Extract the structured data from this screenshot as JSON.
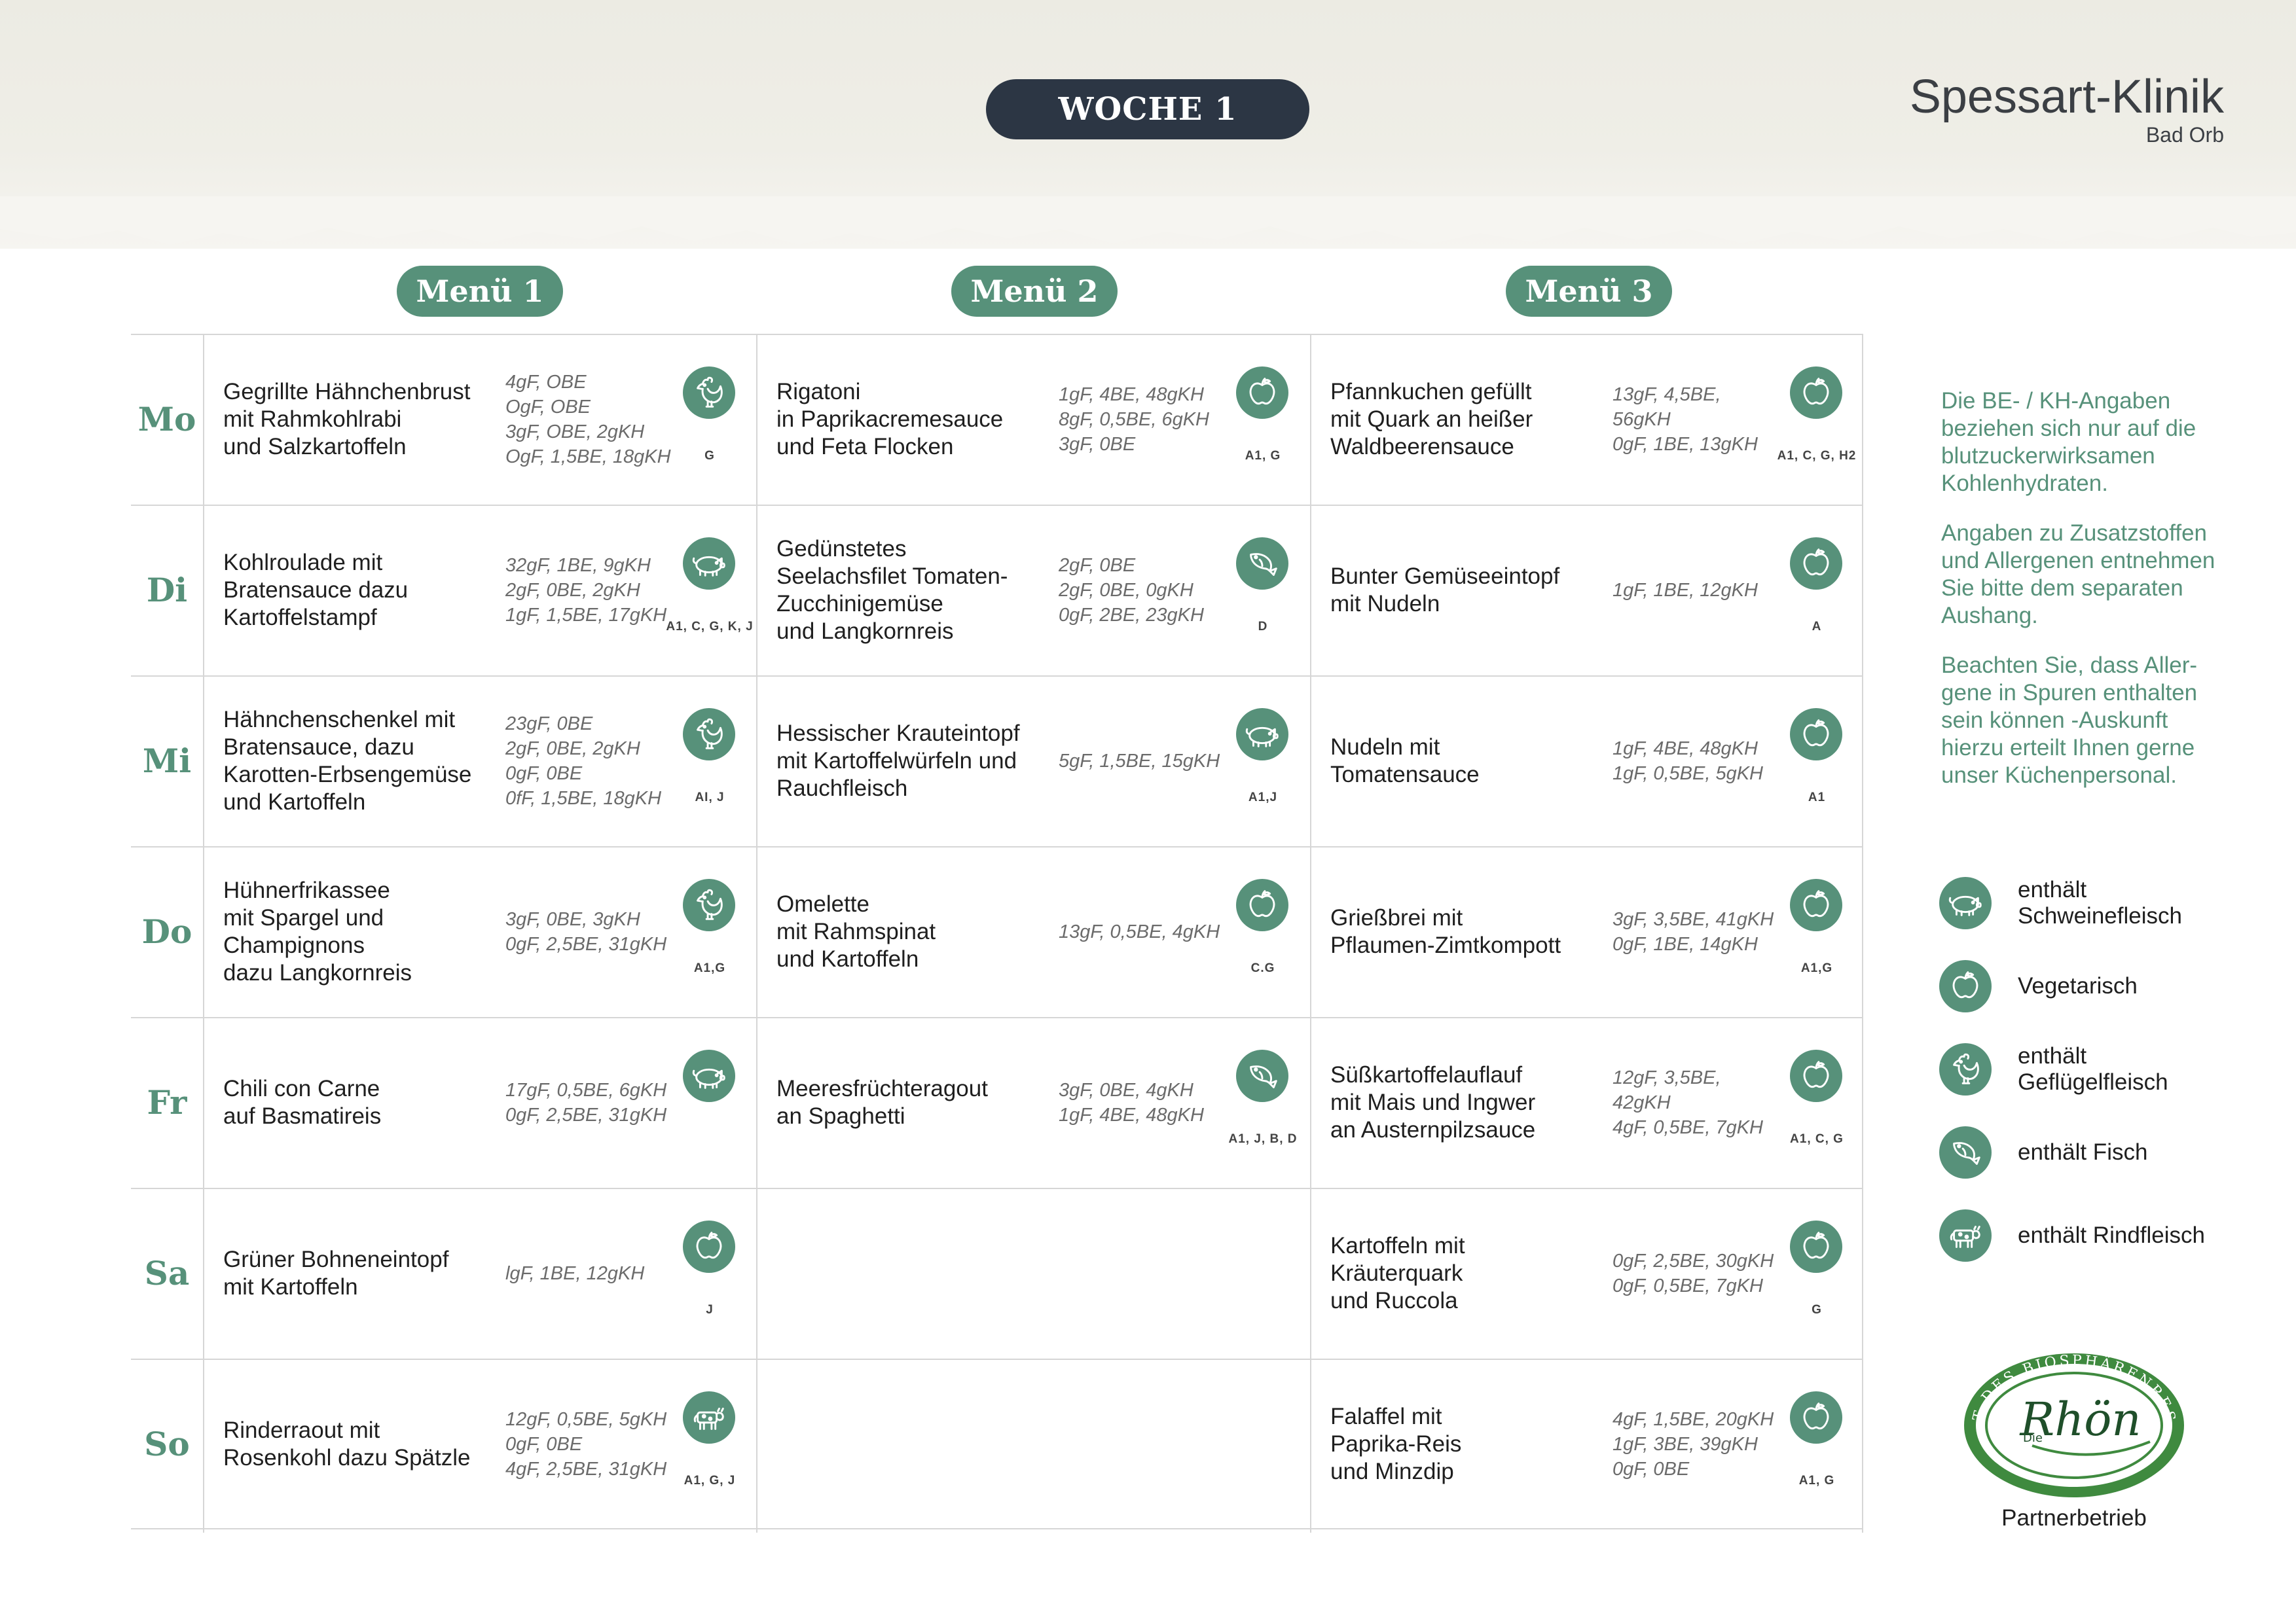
{
  "header": {
    "week": "WOCHE 1",
    "brand": "Spessart-Klinik",
    "brand_sub": "Bad Orb"
  },
  "menus": [
    "Menü 1",
    "Menü 2",
    "Menü 3"
  ],
  "rows": [
    {
      "day": "Mo",
      "cells": [
        {
          "dish": [
            "Gegrillte Hähnchenbrust",
            "mit Rahmkohlrabi",
            "und Salzkartoffeln"
          ],
          "nutri": [
            "4gF, OBE",
            "OgF, OBE",
            "3gF, OBE, 2gKH",
            "OgF, 1,5BE, 18gKH"
          ],
          "icon": "chicken-icon",
          "allergens": "G"
        },
        {
          "dish": [
            "Rigatoni",
            "in Paprikacremesauce",
            "und Feta Flocken"
          ],
          "nutri": [
            "1gF, 4BE, 48gKH",
            "8gF, 0,5BE, 6gKH",
            "3gF, 0BE"
          ],
          "icon": "apple-icon",
          "allergens": "A1, G"
        },
        {
          "dish": [
            "Pfannkuchen gefüllt",
            "mit Quark an heißer",
            "Waldbeerensauce"
          ],
          "nutri": [
            "13gF, 4,5BE,",
            "56gKH",
            "0gF, 1BE, 13gKH"
          ],
          "icon": "apple-icon",
          "allergens": "A1, C, G, H2"
        }
      ]
    },
    {
      "day": "Di",
      "cells": [
        {
          "dish": [
            "Kohlroulade mit",
            "Bratensauce dazu",
            "Kartoffelstampf"
          ],
          "nutri": [
            "32gF, 1BE, 9gKH",
            "2gF, 0BE, 2gKH",
            "1gF, 1,5BE, 17gKH"
          ],
          "icon": "pig-icon",
          "allergens": "A1, C, G, K, J"
        },
        {
          "dish": [
            "Gedünstetes",
            "Seelachsfilet Tomaten-",
            "Zucchinigemüse",
            "und Langkornreis"
          ],
          "nutri": [
            "2gF, 0BE",
            "2gF, 0BE, 0gKH",
            "0gF, 2BE, 23gKH"
          ],
          "icon": "fish-icon",
          "allergens": "D"
        },
        {
          "dish": [
            "Bunter Gemüseeintopf",
            "mit Nudeln"
          ],
          "nutri": [
            "1gF, 1BE, 12gKH"
          ],
          "icon": "apple-icon",
          "allergens": "A"
        }
      ]
    },
    {
      "day": "Mi",
      "cells": [
        {
          "dish": [
            "Hähnchenschenkel mit",
            "Bratensauce, dazu",
            "Karotten-Erbsengemüse",
            "und Kartoffeln"
          ],
          "nutri": [
            "23gF, 0BE",
            "2gF, 0BE, 2gKH",
            "0gF, 0BE",
            "0fF, 1,5BE, 18gKH"
          ],
          "icon": "chicken-icon",
          "allergens": "AI, J"
        },
        {
          "dish": [
            "Hessischer Krauteintopf",
            "mit Kartoffelwürfeln und",
            "Rauchfleisch"
          ],
          "nutri": [
            "5gF, 1,5BE, 15gKH"
          ],
          "icon": "pig-icon",
          "allergens": "A1,J"
        },
        {
          "dish": [
            "Nudeln mit",
            "Tomatensauce"
          ],
          "nutri": [
            "1gF, 4BE, 48gKH",
            "1gF, 0,5BE, 5gKH"
          ],
          "icon": "apple-icon",
          "allergens": "A1"
        }
      ]
    },
    {
      "day": "Do",
      "cells": [
        {
          "dish": [
            "Hühnerfrikassee",
            "mit Spargel und",
            "Champignons",
            "dazu Langkornreis"
          ],
          "nutri": [
            "3gF, 0BE, 3gKH",
            "0gF, 2,5BE, 31gKH"
          ],
          "icon": "chicken-icon",
          "allergens": "A1,G"
        },
        {
          "dish": [
            "Omelette",
            "mit Rahmspinat",
            "und Kartoffeln"
          ],
          "nutri": [
            "13gF, 0,5BE, 4gKH"
          ],
          "icon": "apple-icon",
          "allergens": "C.G"
        },
        {
          "dish": [
            "Grießbrei mit",
            "Pflaumen-Zimtkompott"
          ],
          "nutri": [
            "3gF, 3,5BE, 41gKH",
            "0gF, 1BE, 14gKH"
          ],
          "icon": "apple-icon",
          "allergens": "A1,G"
        }
      ]
    },
    {
      "day": "Fr",
      "cells": [
        {
          "dish": [
            "Chili con Carne",
            "auf Basmatireis"
          ],
          "nutri": [
            "17gF, 0,5BE, 6gKH",
            "0gF, 2,5BE, 31gKH"
          ],
          "icon": "pig-icon",
          "allergens": ""
        },
        {
          "dish": [
            "Meeresfrüchteragout",
            "an Spaghetti"
          ],
          "nutri": [
            "3gF, 0BE, 4gKH",
            "1gF, 4BE, 48gKH"
          ],
          "icon": "fish-icon",
          "allergens": "A1, J, B, D"
        },
        {
          "dish": [
            "Süßkartoffelauflauf",
            "mit Mais und Ingwer",
            "an Austernpilzsauce"
          ],
          "nutri": [
            "12gF, 3,5BE,",
            "42gKH",
            "4gF, 0,5BE, 7gKH"
          ],
          "icon": "apple-icon",
          "allergens": "A1, C, G"
        }
      ]
    },
    {
      "day": "Sa",
      "cells": [
        {
          "dish": [
            "Grüner Bohneneintopf",
            "mit Kartoffeln"
          ],
          "nutri": [
            "lgF, 1BE, 12gKH"
          ],
          "icon": "apple-icon",
          "allergens": "J"
        },
        {
          "dish": [],
          "nutri": [],
          "icon": "",
          "allergens": ""
        },
        {
          "dish": [
            "Kartoffeln mit",
            "Kräuterquark",
            "und Ruccola"
          ],
          "nutri": [
            "0gF, 2,5BE, 30gKH",
            "0gF, 0,5BE, 7gKH"
          ],
          "icon": "apple-icon",
          "allergens": "G"
        }
      ]
    },
    {
      "day": "So",
      "cells": [
        {
          "dish": [
            "Rinderraout mit",
            "Rosenkohl dazu Spätzle"
          ],
          "nutri": [
            "12gF, 0,5BE, 5gKH",
            "0gF, 0BE",
            "4gF, 2,5BE, 31gKH"
          ],
          "icon": "cow-icon",
          "allergens": "A1, G, J"
        },
        {
          "dish": [],
          "nutri": [],
          "icon": "",
          "allergens": ""
        },
        {
          "dish": [
            "Falaffel mit",
            "Paprika-Reis",
            "und Minzdip"
          ],
          "nutri": [
            "4gF, 1,5BE, 20gKH",
            "1gF, 3BE, 39gKH",
            "0gF, 0BE"
          ],
          "icon": "apple-icon",
          "allergens": "A1, G"
        }
      ]
    }
  ],
  "sidebar": {
    "notes": [
      "Die BE- / KH-Angaben beziehen sich nur auf die blutzuckerwirksamen Kohlenhydraten.",
      "Angaben zu Zusatzstoffen und Allergenen entnehmen Sie bitte dem separaten Aushang.",
      "Beachten Sie, dass Aller-gene in Spuren enthalten sein können -Auskunft hierzu erteilt Ihnen gerne unser Küchenpersonal."
    ],
    "legend": [
      {
        "icon": "pig-icon",
        "label": "enthält Schweinefleisch"
      },
      {
        "icon": "apple-icon",
        "label": "Vegetarisch"
      },
      {
        "icon": "chicken-icon",
        "label": "enthält Geflügelfleisch"
      },
      {
        "icon": "fish-icon",
        "label": "enthält Fisch"
      },
      {
        "icon": "cow-icon",
        "label": "enthält Rindfleisch"
      }
    ],
    "seal": {
      "arc_text": "QUALITÄT DES BIOSPHÄRENRESERVATS!",
      "small": "Die",
      "script": "Rhön"
    },
    "partner": "Partnerbetrieb"
  },
  "colors": {
    "accent": "#57917a",
    "dark_pill": "#2c3644",
    "grid": "#d6d6d6"
  }
}
